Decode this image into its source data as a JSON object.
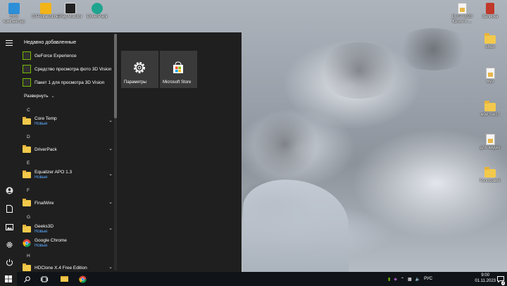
{
  "desktop": {
    "left_icons": [
      {
        "label": "Этот компьютер",
        "icon": "computer-icon"
      },
      {
        "label": "GTAVLauncher",
        "icon": "gta-launcher-icon"
      },
      {
        "label": "Play Monitor",
        "icon": "playstation-icon"
      },
      {
        "label": "DriverPack",
        "icon": "driverpack-icon"
      }
    ],
    "right_icons": [
      {
        "label": "13.07.2023 Юлия и ...",
        "icon": "document-icon"
      },
      {
        "label": "Записка",
        "icon": "notes-icon"
      },
      {
        "label": "обои",
        "icon": "folder-icon"
      },
      {
        "label": "муз",
        "icon": "document-icon"
      },
      {
        "label": "мой текст",
        "icon": "folder-icon"
      },
      {
        "label": "для видео",
        "icon": "document-icon"
      },
      {
        "label": "Голосовой",
        "icon": "folder-icon"
      }
    ]
  },
  "start_menu": {
    "recent_header": "Недавно добавленные",
    "recent_items": [
      {
        "label": "GeForce Experience",
        "icon": "geforce-icon"
      },
      {
        "label": "Средство просмотра фото 3D Vision",
        "icon": "nvidia-3d-icon"
      },
      {
        "label": "Пакет 1 для просмотра 3D Vision",
        "icon": "nvidia-3d-icon"
      }
    ],
    "expand_label": "Развернуть",
    "new_badge": "Новые",
    "letters": [
      "C",
      "D",
      "E",
      "F",
      "G",
      "H"
    ],
    "apps": [
      {
        "label": "Core Temp",
        "badge": "Новые"
      },
      {
        "label": "DriverPack"
      },
      {
        "label": "Equalizer APO 1.3",
        "badge": "Новые"
      },
      {
        "label": "FinalWire"
      },
      {
        "label": "Geeks3D",
        "badge": "Новые"
      },
      {
        "label": "Google Chrome",
        "badge": "Новые"
      },
      {
        "label": "HDClone X.4 Free Edition"
      }
    ],
    "tiles": [
      {
        "label": "Параметры",
        "icon": "gear-icon"
      },
      {
        "label": "Microsoft Store",
        "icon": "store-icon"
      }
    ]
  },
  "taskbar": {
    "language": "РУС",
    "time": "9:00",
    "date": "01.11.2023",
    "notification_count": "2"
  },
  "colors": {
    "menu_bg": "#1f1f1f",
    "tile_bg": "#3a3a3a",
    "badge_blue": "#5aa9ff",
    "taskbar_bg": "#101418"
  }
}
